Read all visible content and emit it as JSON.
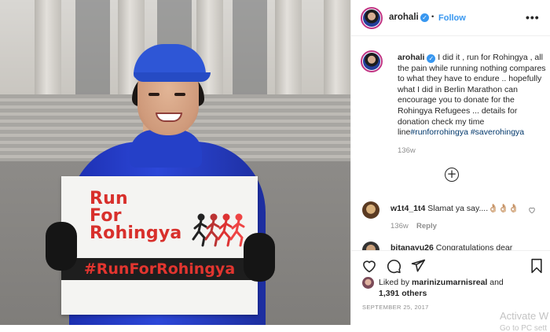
{
  "post": {
    "username": "arohali",
    "follow_label": "Follow",
    "separator": "•",
    "more_label": "•••",
    "caption": "I did it , run for Rohingya , all the pain while running nothing compares to what they have to endure .. hopefully what I did in Berlin Marathon can encourage you to donate for the Rohingya Refugees ... details for donation check my time line",
    "hashtags": "#runforrohingya #saverohingya",
    "caption_time": "136w",
    "load_more_label": "+",
    "comments": [
      {
        "username": "w1t4_1t4",
        "text": "Slamat ya say....👌🏼👌🏼👌🏼",
        "time": "136w",
        "reply_label": "Reply"
      },
      {
        "username": "bitanayu26",
        "text": "Congratulations dear"
      }
    ],
    "liked_by_prefix": "Liked by",
    "liked_by_user": "marinizumarnisreal",
    "liked_by_and": "and",
    "likes_count": "1,391 others",
    "date": "SEPTEMBER 25, 2017"
  },
  "sign": {
    "title_line1": "Run",
    "title_line2": "For",
    "title_line3": "Rohingya",
    "hashtag": "#RunForRohingya"
  },
  "watermark": {
    "line1": "Activate W",
    "line2": "Go to PC sett"
  },
  "colors": {
    "accent": "#3897f0",
    "sign_red": "#d8302c",
    "jacket_blue": "#2c47d8"
  },
  "icons": {
    "verified": "verified-badge-icon",
    "like": "heart-icon",
    "comment": "comment-bubble-icon",
    "share": "paper-plane-icon",
    "save": "bookmark-icon",
    "more": "more-options-icon",
    "load_more": "plus-circle-icon"
  }
}
